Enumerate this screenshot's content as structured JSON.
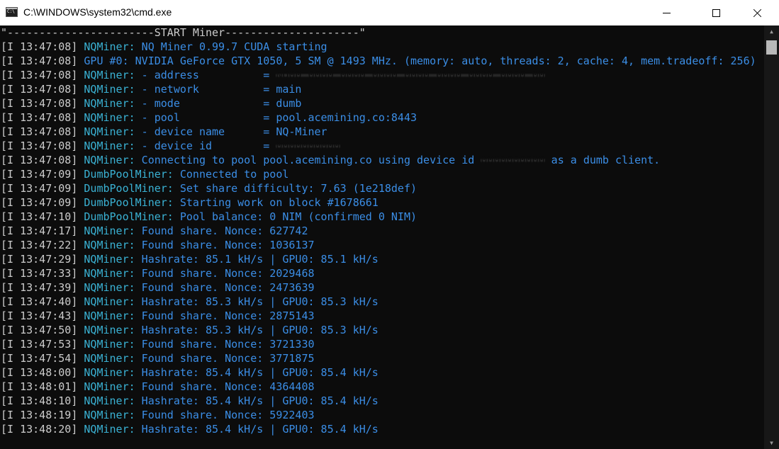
{
  "window": {
    "title": "C:\\WINDOWS\\system32\\cmd.exe",
    "controls": {
      "minimize": "minimize",
      "maximize": "maximize",
      "close": "close"
    }
  },
  "console": {
    "header": "\"-----------------------START Miner---------------------\"",
    "lines": [
      {
        "ts": "[I 13:47:08]",
        "src": "NQMiner:",
        "msg": " NQ Miner 0.99.7 CUDA starting"
      },
      {
        "ts": "[I 13:47:08]",
        "src": "",
        "msg": "GPU #0: NVIDIA GeForce GTX 1050, 5 SM @ 1493 MHz. (memory: auto, threads: 2, cache: 4, mem.tradeoff: 256)"
      },
      {
        "ts": "[I 13:47:08]",
        "src": "NQMiner:",
        "msg": " - address          = ",
        "redact": "NQ00 0000 0000 0000 0000 0000 0000 0000 00"
      },
      {
        "ts": "[I 13:47:08]",
        "src": "NQMiner:",
        "msg": " - network          = main"
      },
      {
        "ts": "[I 13:47:08]",
        "src": "NQMiner:",
        "msg": " - mode             = dumb"
      },
      {
        "ts": "[I 13:47:08]",
        "src": "NQMiner:",
        "msg": " - pool             = pool.acemining.co:8443"
      },
      {
        "ts": "[I 13:47:08]",
        "src": "NQMiner:",
        "msg": " - device name      = NQ-Miner"
      },
      {
        "ts": "[I 13:47:08]",
        "src": "NQMiner:",
        "msg": " - device id        = ",
        "redact": "0000000000"
      },
      {
        "ts": "[I 13:47:08]",
        "src": "NQMiner:",
        "msg": " Connecting to pool pool.acemining.co using device id ",
        "redact": "0000000000",
        "tail": " as a dumb client."
      },
      {
        "ts": "[I 13:47:09]",
        "src": "DumbPoolMiner:",
        "msg": " Connected to pool"
      },
      {
        "ts": "[I 13:47:09]",
        "src": "DumbPoolMiner:",
        "msg": " Set share difficulty: 7.63 (1e218def)"
      },
      {
        "ts": "[I 13:47:09]",
        "src": "DumbPoolMiner:",
        "msg": " Starting work on block #1678661"
      },
      {
        "ts": "[I 13:47:10]",
        "src": "DumbPoolMiner:",
        "msg": " Pool balance: 0 NIM (confirmed 0 NIM)"
      },
      {
        "ts": "[I 13:47:17]",
        "src": "NQMiner:",
        "msg": " Found share. Nonce: 627742"
      },
      {
        "ts": "[I 13:47:22]",
        "src": "NQMiner:",
        "msg": " Found share. Nonce: 1036137"
      },
      {
        "ts": "[I 13:47:29]",
        "src": "NQMiner:",
        "msg": " Hashrate: 85.1 kH/s | GPU0: 85.1 kH/s"
      },
      {
        "ts": "[I 13:47:33]",
        "src": "NQMiner:",
        "msg": " Found share. Nonce: 2029468"
      },
      {
        "ts": "[I 13:47:39]",
        "src": "NQMiner:",
        "msg": " Found share. Nonce: 2473639"
      },
      {
        "ts": "[I 13:47:40]",
        "src": "NQMiner:",
        "msg": " Hashrate: 85.3 kH/s | GPU0: 85.3 kH/s"
      },
      {
        "ts": "[I 13:47:43]",
        "src": "NQMiner:",
        "msg": " Found share. Nonce: 2875143"
      },
      {
        "ts": "[I 13:47:50]",
        "src": "NQMiner:",
        "msg": " Hashrate: 85.3 kH/s | GPU0: 85.3 kH/s"
      },
      {
        "ts": "[I 13:47:53]",
        "src": "NQMiner:",
        "msg": " Found share. Nonce: 3721330"
      },
      {
        "ts": "[I 13:47:54]",
        "src": "NQMiner:",
        "msg": " Found share. Nonce: 3771875"
      },
      {
        "ts": "[I 13:48:00]",
        "src": "NQMiner:",
        "msg": " Hashrate: 85.4 kH/s | GPU0: 85.4 kH/s"
      },
      {
        "ts": "[I 13:48:01]",
        "src": "NQMiner:",
        "msg": " Found share. Nonce: 4364408"
      },
      {
        "ts": "[I 13:48:10]",
        "src": "NQMiner:",
        "msg": " Hashrate: 85.4 kH/s | GPU0: 85.4 kH/s"
      },
      {
        "ts": "[I 13:48:19]",
        "src": "NQMiner:",
        "msg": " Found share. Nonce: 5922403"
      },
      {
        "ts": "[I 13:48:20]",
        "src": "NQMiner:",
        "msg": " Hashrate: 85.4 kH/s | GPU0: 85.4 kH/s"
      }
    ]
  },
  "colors": {
    "background": "#0c0c0c",
    "timestamp": "#cccccc",
    "source": "#3ab2d4",
    "message": "#3b8ee6"
  },
  "scrollbar": {
    "up_icon": "scroll-up-arrow",
    "down_icon": "scroll-down-arrow"
  }
}
